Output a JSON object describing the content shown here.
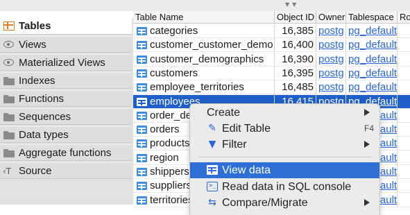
{
  "sidebar": {
    "items": [
      {
        "label": "Tables",
        "icon": "tables-icon",
        "active": true
      },
      {
        "label": "Views",
        "icon": "eye-icon"
      },
      {
        "label": "Materialized Views",
        "icon": "eye-icon"
      },
      {
        "label": "Indexes",
        "icon": "folder-icon"
      },
      {
        "label": "Functions",
        "icon": "folder-icon"
      },
      {
        "label": "Sequences",
        "icon": "folder-icon"
      },
      {
        "label": "Data types",
        "icon": "folder-icon"
      },
      {
        "label": "Aggregate functions",
        "icon": "folder-icon"
      },
      {
        "label": "Source",
        "icon": "source-icon"
      }
    ]
  },
  "grid": {
    "columns": [
      "Table Name",
      "Object ID",
      "Owner",
      "Tablespace",
      "Ro"
    ],
    "rows": [
      {
        "name": "categories",
        "oid": "16,385",
        "owner": "postg",
        "ts": "pg_default"
      },
      {
        "name": "customer_customer_demo",
        "oid": "16,400",
        "owner": "postg",
        "ts": "pg_default"
      },
      {
        "name": "customer_demographics",
        "oid": "16,390",
        "owner": "postg",
        "ts": "pg_default"
      },
      {
        "name": "customers",
        "oid": "16,395",
        "owner": "postg",
        "ts": "pg_default"
      },
      {
        "name": "employee_territories",
        "oid": "16,485",
        "owner": "postg",
        "ts": "pg_default"
      },
      {
        "name": "employees",
        "oid": "16,415",
        "owner": "postg",
        "ts": "pg_default",
        "selected": true
      },
      {
        "name": "order_details",
        "oid": "",
        "owner": "",
        "ts": "pg_default"
      },
      {
        "name": "orders",
        "oid": "",
        "owner": "",
        "ts": "pg_default"
      },
      {
        "name": "products",
        "oid": "",
        "owner": "",
        "ts": "pg_default"
      },
      {
        "name": "region",
        "oid": "",
        "owner": "",
        "ts": "pg_default"
      },
      {
        "name": "shippers",
        "oid": "",
        "owner": "",
        "ts": "pg_default"
      },
      {
        "name": "suppliers",
        "oid": "",
        "owner": "",
        "ts": "pg_default"
      },
      {
        "name": "territories",
        "oid": "",
        "owner": "",
        "ts": "pg_default"
      }
    ]
  },
  "context_menu": {
    "create": "Create",
    "edit_table": "Edit Table",
    "edit_shortcut": "F4",
    "filter": "Filter",
    "view_data": "View data",
    "read_sql": "Read data in SQL console",
    "compare": "Compare/Migrate"
  },
  "colors": {
    "selection": "#1f5fc9",
    "menu_highlight": "#2f6fd6",
    "link": "#2a66d9",
    "tables_icon": "#e07b18"
  }
}
